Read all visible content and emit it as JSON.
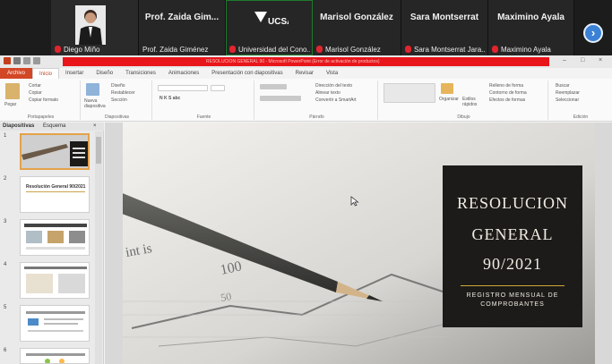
{
  "meeting": {
    "participants": [
      {
        "name": "",
        "caption": "Diego Miño"
      },
      {
        "name": "Prof. Zaida Gim...",
        "caption": "Prof. Zaida Giménez"
      },
      {
        "name": "",
        "caption": "Universidad del Cono..."
      },
      {
        "name": "Marisol González",
        "caption": "Marisol González"
      },
      {
        "name": "Sara Montserrat",
        "caption": "Sara Montserrat Jara..."
      },
      {
        "name": "Maximino Ayala",
        "caption": "Maximino Ayala"
      }
    ],
    "logo_text": "UCSA",
    "next_icon": "chevron-right-icon"
  },
  "ppt": {
    "title_bar_text": "RESOLUCION GENERAL 90 - Microsoft PowerPoint (Error de activación de productos)",
    "tabs": [
      "Archivo",
      "Inicio",
      "Insertar",
      "Diseño",
      "Transiciones",
      "Animaciones",
      "Presentación con diapositivas",
      "Revisar",
      "Vista"
    ],
    "active_tab": "Inicio",
    "ribbon": {
      "groups": [
        "Portapapeles",
        "Diapositivas",
        "Fuente",
        "Párrafo",
        "Dibujo",
        "Edición"
      ],
      "clipboard": {
        "paste": "Pegar",
        "cut": "Cortar",
        "copy": "Copiar",
        "format": "Copiar formato"
      },
      "slides": {
        "new": "Nueva diapositiva",
        "layout": "Diseño",
        "reset": "Restablecer",
        "section": "Sección"
      },
      "paragraph": {
        "direction": "Dirección del texto",
        "align": "Alinear texto",
        "smartart": "Convertir a SmartArt"
      },
      "drawing": {
        "arrange": "Organizar",
        "quick": "Estilos rápidos",
        "fill": "Relleno de forma",
        "outline": "Contorno de forma",
        "effects": "Efectos de formas"
      },
      "editing": {
        "find": "Buscar",
        "replace": "Reemplazar",
        "select": "Seleccionar"
      }
    },
    "pane_tabs": [
      "Diapositivas",
      "Esquema"
    ],
    "slide_numbers": [
      "1",
      "2",
      "3",
      "4",
      "5",
      "6"
    ],
    "thumb2_title": "Resolución General 90/2021"
  },
  "slide": {
    "line1": "RESOLUCION",
    "line2": "GENERAL",
    "line3": "90/2021",
    "sub1": "REGISTRO MENSUAL DE",
    "sub2": "COMPROBANTES",
    "bg_text_1": "int is",
    "bg_text_2": "100",
    "bg_text_3": "50"
  },
  "colors": {
    "accent_red": "#e8161b",
    "file_tab": "#d24726",
    "title_box": "#1d1b19",
    "gold": "#cfa83a"
  }
}
